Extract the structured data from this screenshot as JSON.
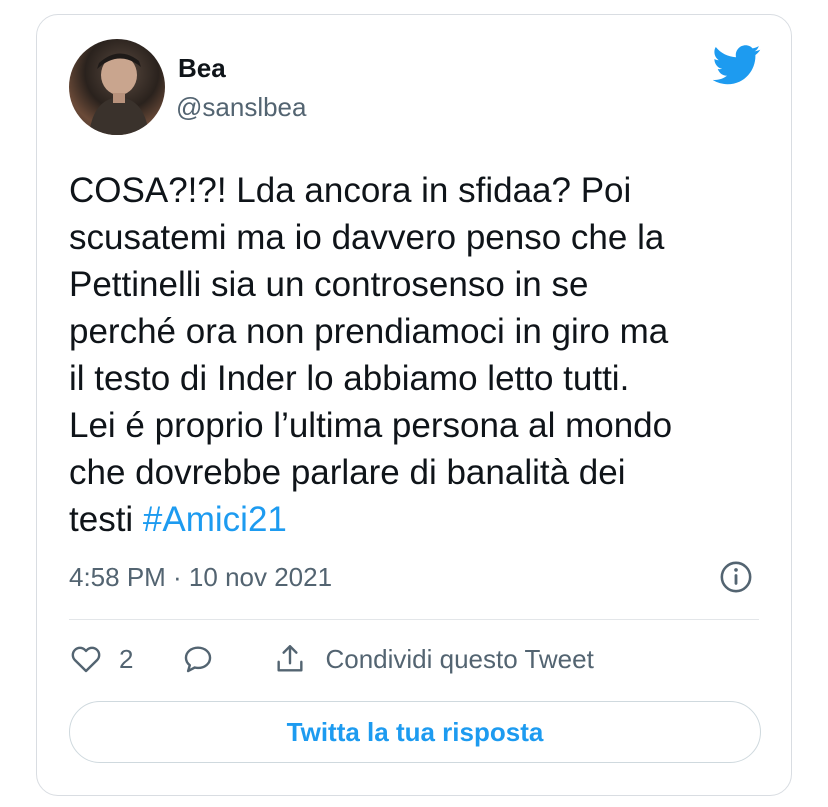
{
  "author": {
    "display_name": "Bea",
    "handle": "@sanslbea"
  },
  "tweet": {
    "text": "COSA?!?! Lda ancora in sfidaa? Poi\nscusatemi ma io davvero penso che la\nPettinelli sia un controsenso in se\nperché ora non prendiamoci in giro ma\nil testo di Inder lo abbiamo letto tutti.\nLei é proprio l’ultima persona al mondo\nche dovrebbe parlare di banalità dei\ntesti ",
    "hashtag": "#Amici21",
    "timestamp": "4:58 PM · 10 nov 2021"
  },
  "actions": {
    "like_count": "2",
    "share_label": "Condividi questo Tweet"
  },
  "reply_button": {
    "label": "Twitta la tua risposta"
  },
  "icons": {
    "brand": "twitter-bird-icon",
    "info": "info-icon",
    "like": "heart-icon",
    "reply": "speech-bubble-icon",
    "share": "share-upload-icon"
  },
  "colors": {
    "brand_blue": "#1d9bf0",
    "text_primary": "#0f1419",
    "text_secondary": "#536471",
    "border": "#d9dde2"
  }
}
